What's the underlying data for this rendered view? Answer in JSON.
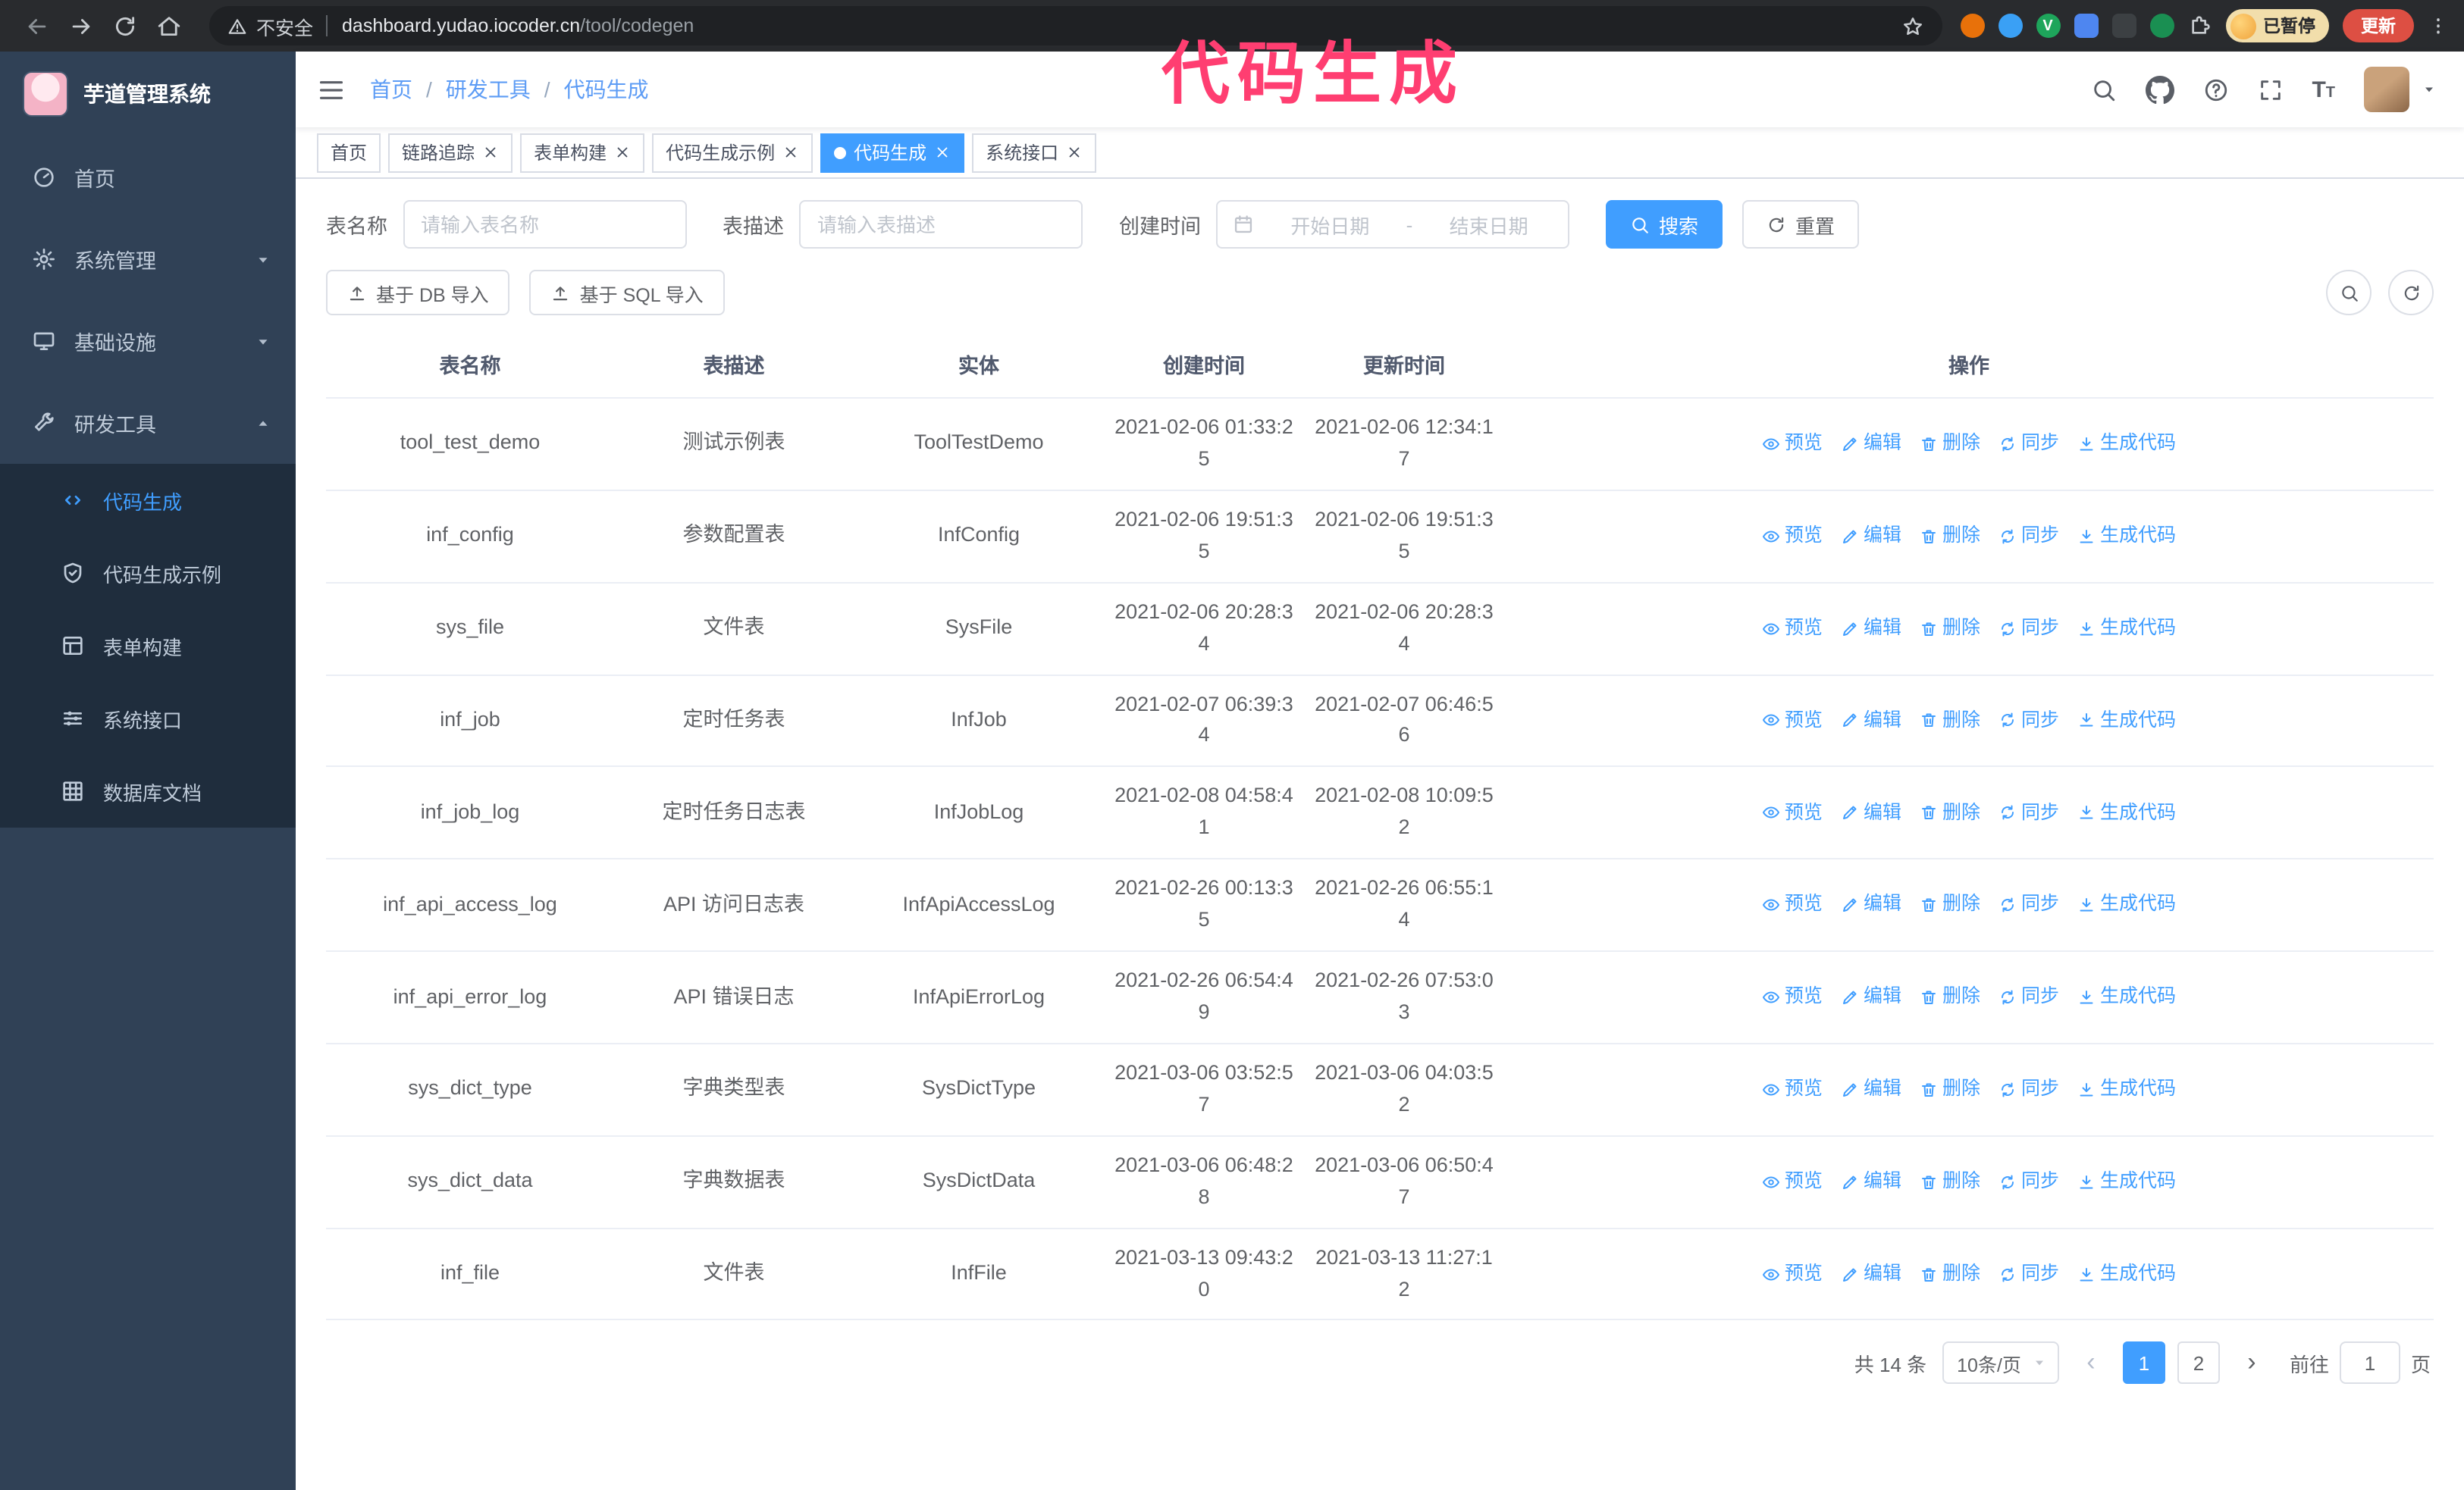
{
  "browser": {
    "security_label": "不安全",
    "url_domain": "dashboard.yudao.iocoder.cn",
    "url_path": "/tool/codegen",
    "extensions": [
      {
        "name": "extension-orange",
        "color": "#e8710a",
        "shape": "round",
        "glyph": ""
      },
      {
        "name": "extension-blue-drop",
        "color": "#3aa0f5",
        "shape": "round",
        "glyph": ""
      },
      {
        "name": "extension-green-check",
        "color": "#1ea55b",
        "shape": "round",
        "glyph": "V"
      },
      {
        "name": "extension-people",
        "color": "#4e86f0",
        "shape": "square",
        "glyph": ""
      },
      {
        "name": "extension-screen",
        "color": "#3c4043",
        "shape": "square",
        "glyph": ""
      },
      {
        "name": "extension-leaf",
        "color": "#1a8f52",
        "shape": "round",
        "glyph": ""
      }
    ],
    "profile_badge": "已暂停",
    "update_button": "更新"
  },
  "annotation": {
    "text": "代码生成",
    "color": "#ff3e71"
  },
  "theme": {
    "primary": "#409eff",
    "sidebar_bg": "#304156",
    "submenu_bg": "#1f2d3d"
  },
  "sidebar": {
    "logo_title": "芋道管理系统",
    "items": [
      {
        "label": "首页",
        "icon": "home-icon"
      },
      {
        "label": "系统管理",
        "icon": "gear-icon",
        "chevron": "down"
      },
      {
        "label": "基础设施",
        "icon": "infra-icon",
        "chevron": "down"
      },
      {
        "label": "研发工具",
        "icon": "tools-icon",
        "chevron": "up",
        "expanded": true
      }
    ],
    "subitems": [
      {
        "label": "代码生成",
        "active": true
      },
      {
        "label": "代码生成示例"
      },
      {
        "label": "表单构建"
      },
      {
        "label": "系统接口"
      },
      {
        "label": "数据库文档"
      }
    ]
  },
  "header": {
    "breadcrumb": [
      "首页",
      "研发工具",
      "代码生成"
    ]
  },
  "tabs": [
    {
      "label": "首页",
      "closable": false
    },
    {
      "label": "链路追踪",
      "closable": true
    },
    {
      "label": "表单构建",
      "closable": true
    },
    {
      "label": "代码生成示例",
      "closable": true
    },
    {
      "label": "代码生成",
      "closable": true,
      "active": true
    },
    {
      "label": "系统接口",
      "closable": true
    }
  ],
  "filters": {
    "table_name_label": "表名称",
    "table_name_placeholder": "请输入表名称",
    "table_desc_label": "表描述",
    "table_desc_placeholder": "请输入表描述",
    "create_time_label": "创建时间",
    "date_start_placeholder": "开始日期",
    "date_separator": "-",
    "date_end_placeholder": "结束日期",
    "search_button": "搜索",
    "reset_button": "重置"
  },
  "toolbar": {
    "import_db": "基于 DB 导入",
    "import_sql": "基于 SQL 导入"
  },
  "table": {
    "columns": [
      "表名称",
      "表描述",
      "实体",
      "创建时间",
      "更新时间",
      "操作"
    ],
    "op_labels": [
      "预览",
      "编辑",
      "删除",
      "同步",
      "生成代码"
    ],
    "rows": [
      {
        "name": "tool_test_demo",
        "desc": "测试示例表",
        "entity": "ToolTestDemo",
        "created": "2021-02-06 01:33:25",
        "updated": "2021-02-06 12:34:17"
      },
      {
        "name": "inf_config",
        "desc": "参数配置表",
        "entity": "InfConfig",
        "created": "2021-02-06 19:51:35",
        "updated": "2021-02-06 19:51:35"
      },
      {
        "name": "sys_file",
        "desc": "文件表",
        "entity": "SysFile",
        "created": "2021-02-06 20:28:34",
        "updated": "2021-02-06 20:28:34"
      },
      {
        "name": "inf_job",
        "desc": "定时任务表",
        "entity": "InfJob",
        "created": "2021-02-07 06:39:34",
        "updated": "2021-02-07 06:46:56"
      },
      {
        "name": "inf_job_log",
        "desc": "定时任务日志表",
        "entity": "InfJobLog",
        "created": "2021-02-08 04:58:41",
        "updated": "2021-02-08 10:09:52"
      },
      {
        "name": "inf_api_access_log",
        "desc": "API 访问日志表",
        "entity": "InfApiAccessLog",
        "created": "2021-02-26 00:13:35",
        "updated": "2021-02-26 06:55:14"
      },
      {
        "name": "inf_api_error_log",
        "desc": "API 错误日志",
        "entity": "InfApiErrorLog",
        "created": "2021-02-26 06:54:49",
        "updated": "2021-02-26 07:53:03"
      },
      {
        "name": "sys_dict_type",
        "desc": "字典类型表",
        "entity": "SysDictType",
        "created": "2021-03-06 03:52:57",
        "updated": "2021-03-06 04:03:52"
      },
      {
        "name": "sys_dict_data",
        "desc": "字典数据表",
        "entity": "SysDictData",
        "created": "2021-03-06 06:48:28",
        "updated": "2021-03-06 06:50:47"
      },
      {
        "name": "inf_file",
        "desc": "文件表",
        "entity": "InfFile",
        "created": "2021-03-13 09:43:20",
        "updated": "2021-03-13 11:27:12"
      }
    ]
  },
  "pagination": {
    "total_text": "共 14 条",
    "page_size": "10条/页",
    "prev_symbol": "‹",
    "next_symbol": "›",
    "pages": [
      "1",
      "2"
    ],
    "active_page": "1",
    "goto_prefix": "前往",
    "goto_value": "1",
    "goto_suffix": "页"
  }
}
